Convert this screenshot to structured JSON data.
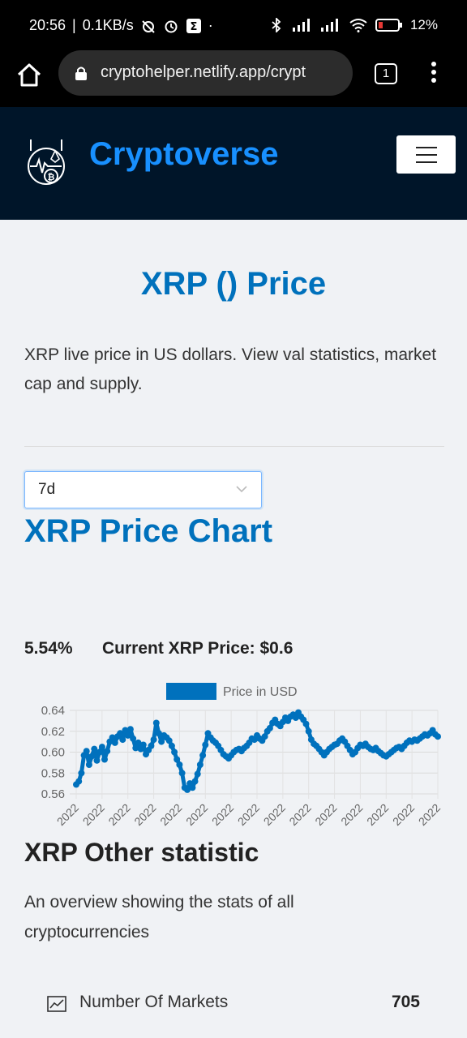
{
  "status_bar": {
    "time": "20:56",
    "net_speed": "0.1KB/s",
    "battery": "12%"
  },
  "browser": {
    "url": "cryptohelper.netlify.app/crypt",
    "tab_count": "1"
  },
  "navbar": {
    "brand": "Cryptoverse"
  },
  "coin": {
    "title": "XRP () Price",
    "description": "XRP live price in US dollars. View val statistics, market cap and supply."
  },
  "time_period": {
    "selected": "7d"
  },
  "price_chart": {
    "heading": "XRP Price Chart",
    "change": "5.54%",
    "current_price": "Current XRP Price: $0.6"
  },
  "chart_data": {
    "type": "line",
    "series": [
      {
        "name": "Price in USD",
        "values": [
          0.569,
          0.572,
          0.58,
          0.597,
          0.601,
          0.588,
          0.596,
          0.603,
          0.592,
          0.6,
          0.605,
          0.593,
          0.601,
          0.61,
          0.614,
          0.609,
          0.615,
          0.618,
          0.612,
          0.621,
          0.616,
          0.622,
          0.613,
          0.604,
          0.609,
          0.603,
          0.607,
          0.598,
          0.602,
          0.606,
          0.612,
          0.628,
          0.618,
          0.61,
          0.616,
          0.614,
          0.611,
          0.606,
          0.6,
          0.593,
          0.588,
          0.58,
          0.566,
          0.564,
          0.57,
          0.566,
          0.572,
          0.579,
          0.588,
          0.597,
          0.607,
          0.618,
          0.614,
          0.611,
          0.609,
          0.606,
          0.602,
          0.598,
          0.596,
          0.594,
          0.597,
          0.6,
          0.602,
          0.603,
          0.601,
          0.604,
          0.606,
          0.609,
          0.613,
          0.612,
          0.616,
          0.613,
          0.611,
          0.615,
          0.62,
          0.623,
          0.628,
          0.631,
          0.627,
          0.625,
          0.629,
          0.633,
          0.63,
          0.634,
          0.636,
          0.633,
          0.638,
          0.634,
          0.631,
          0.627,
          0.62,
          0.612,
          0.608,
          0.606,
          0.603,
          0.6,
          0.597,
          0.6,
          0.603,
          0.605,
          0.607,
          0.608,
          0.611,
          0.613,
          0.61,
          0.606,
          0.602,
          0.598,
          0.6,
          0.604,
          0.607,
          0.606,
          0.608,
          0.605,
          0.603,
          0.602,
          0.604,
          0.601,
          0.599,
          0.597,
          0.596,
          0.598,
          0.6,
          0.602,
          0.604,
          0.605,
          0.603,
          0.606,
          0.609,
          0.611,
          0.61,
          0.612,
          0.611,
          0.613,
          0.615,
          0.617,
          0.616,
          0.618,
          0.621,
          0.617,
          0.615
        ]
      }
    ],
    "x_tick_labels": [
      "2022",
      "2022",
      "2022",
      "2022",
      "2022",
      "2022",
      "2022",
      "2022",
      "2022",
      "2022",
      "2022",
      "2022",
      "2022",
      "2022",
      "2022"
    ],
    "y_ticks": [
      0.56,
      0.58,
      0.6,
      0.62,
      0.64
    ],
    "y_tick_labels": [
      "0.56",
      "0.58",
      "0.60",
      "0.62",
      "0.64"
    ],
    "ylim": [
      0.56,
      0.64
    ],
    "legend_position": "top-center",
    "grid": true,
    "line_color": "#0071bd"
  },
  "statistics": {
    "heading": "XRP Other statistic",
    "description": "An overview showing the stats of all cryptocurrencies",
    "rows": [
      {
        "label": "Number Of Markets",
        "value": "705"
      }
    ]
  }
}
